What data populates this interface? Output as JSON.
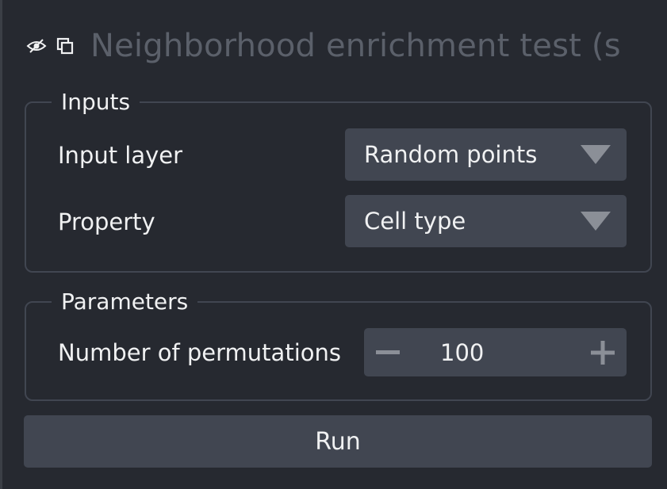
{
  "panel": {
    "title": "Neighborhood enrichment test (sc",
    "icons": [
      "eye-hidden-icon",
      "float-window-icon"
    ]
  },
  "inputs": {
    "group_title": "Inputs",
    "input_layer": {
      "label": "Input layer",
      "value": "Random points"
    },
    "property": {
      "label": "Property",
      "value": "Cell type"
    }
  },
  "parameters": {
    "group_title": "Parameters",
    "permutations": {
      "label": "Number of permutations",
      "value": "100",
      "decrement": "−",
      "increment": "+"
    }
  },
  "actions": {
    "run_label": "Run"
  },
  "colors": {
    "background": "#262930",
    "control": "#414651",
    "text": "#f0f1f2",
    "title_muted": "#5b606a",
    "arrow": "#8b8f97"
  }
}
